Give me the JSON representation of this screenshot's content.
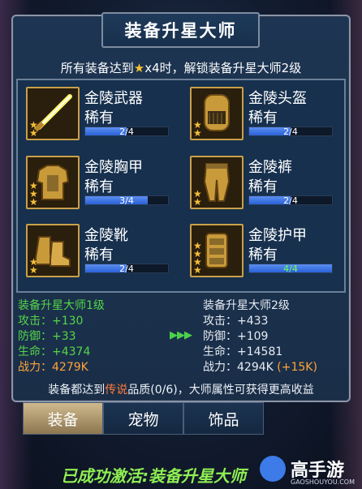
{
  "title": "装备升星大师",
  "unlock_prefix": "所有装备达到",
  "unlock_star": "★",
  "unlock_suffix": "x4时，解锁装备升星大师2级",
  "items": [
    {
      "name": "金陵武器",
      "rarity": "稀有",
      "progress_text": "2/4",
      "progress": 0.5,
      "stars": 2,
      "icon": "golden-sword-icon"
    },
    {
      "name": "金陵头盔",
      "rarity": "稀有",
      "progress_text": "2/4",
      "progress": 0.5,
      "stars": 2,
      "icon": "golden-helmet-icon"
    },
    {
      "name": "金陵胸甲",
      "rarity": "稀有",
      "progress_text": "3/4",
      "progress": 0.75,
      "stars": 3,
      "icon": "golden-chestplate-icon"
    },
    {
      "name": "金陵裤",
      "rarity": "稀有",
      "progress_text": "2/4",
      "progress": 0.5,
      "stars": 2,
      "icon": "golden-pants-icon"
    },
    {
      "name": "金陵靴",
      "rarity": "稀有",
      "progress_text": "2/4",
      "progress": 0.5,
      "stars": 2,
      "icon": "golden-boots-icon"
    },
    {
      "name": "金陵护甲",
      "rarity": "稀有",
      "progress_text": "4/4",
      "progress": 1.0,
      "stars": 4,
      "icon": "golden-armor-icon"
    }
  ],
  "left_stats": {
    "title": "装备升星大师1级",
    "attack": "攻击：+130",
    "defense": "防御：+33",
    "hp": "生命：+4374",
    "power": "战力：4279K"
  },
  "right_stats": {
    "title": "装备升星大师2级",
    "attack": "攻击：+433",
    "defense": "防御：+109",
    "hp": "生命：+14581",
    "power": "战力：4294K",
    "power_bonus": "(+15K)"
  },
  "arrows": "▶▶▶",
  "note_prefix": "装备都达到",
  "note_legend": "传说",
  "note_suffix": "品质(0/6)，大师属性可获得更高收益",
  "tabs": [
    "装备",
    "宠物",
    "饰品"
  ],
  "activated_text": "已成功激活:装备升星大师",
  "watermark": {
    "text": "高手游",
    "url": "GAOSHOUYOU.COM"
  },
  "colors": {
    "accent_green": "#54d649",
    "orange": "#ffa43a",
    "gold": "#f5c03a",
    "bar_blue": "#2a62d8"
  }
}
